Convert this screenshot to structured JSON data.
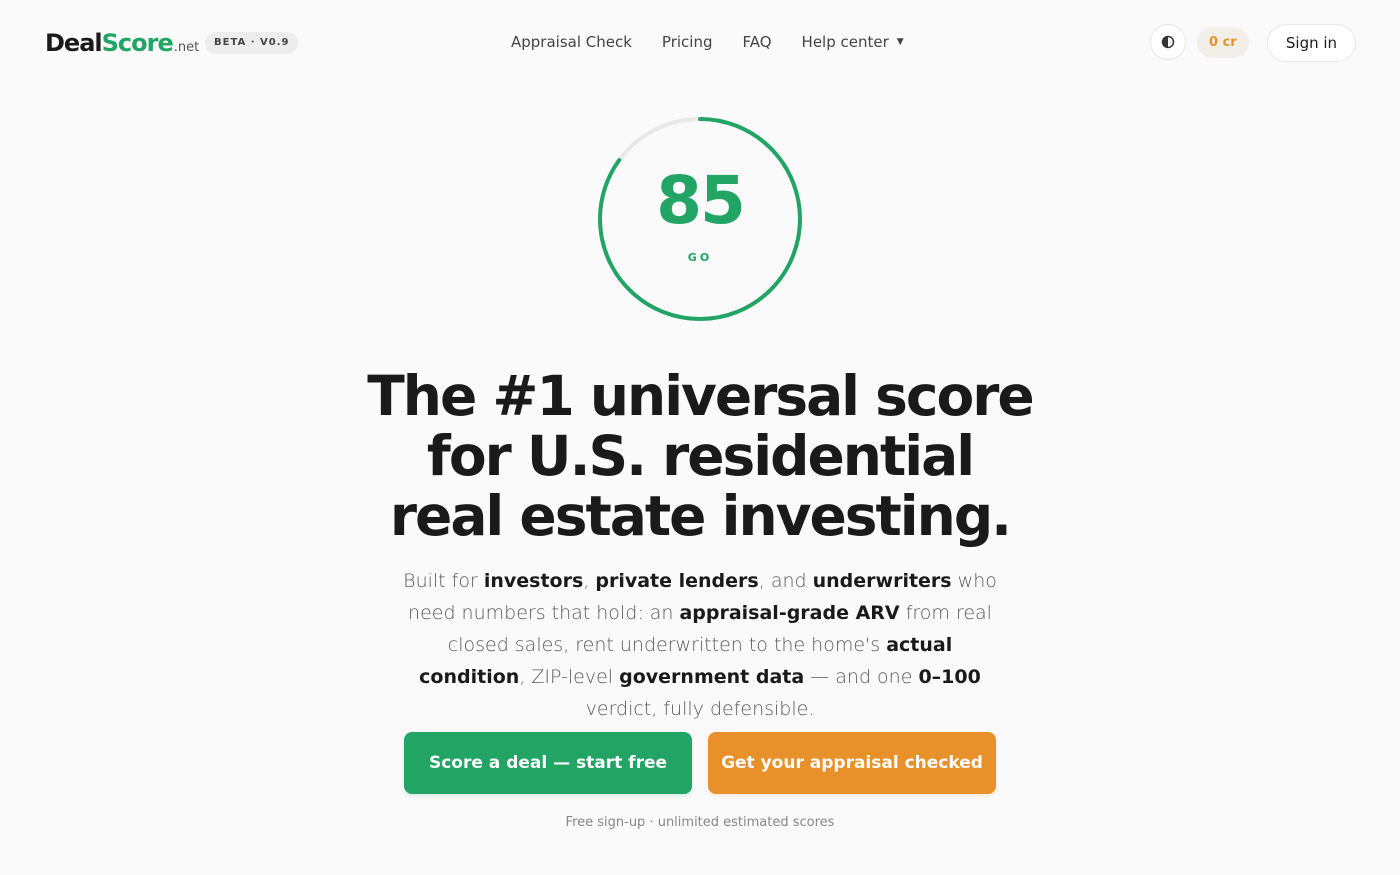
{
  "header": {
    "logo": {
      "part1": "Deal",
      "part2": "Score",
      "tld": ".net"
    },
    "badge": "BETA · V0.9",
    "nav": [
      {
        "label": "Appraisal Check"
      },
      {
        "label": "Pricing"
      },
      {
        "label": "FAQ"
      },
      {
        "label": "Help center"
      }
    ],
    "theme_icon": "half-circle-icon",
    "credits": "0 cr",
    "signin_label": "Sign in"
  },
  "score": {
    "value": "85",
    "verdict": "GO",
    "fraction": 0.85
  },
  "headline": {
    "line1": "The #1 universal score",
    "line2": "for U.S. residential",
    "line3": "real estate investing."
  },
  "subtext": {
    "t1": "Built for ",
    "b1": "investors",
    "t2": ", ",
    "b2": "private lenders",
    "t3": ", and ",
    "b3": "underwriters",
    "t4": " who need numbers that hold: an ",
    "b4": "appraisal-grade ARV",
    "t5": " from real closed sales, rent underwritten to the home's ",
    "b5": "actual condition",
    "t6": ", ZIP-level ",
    "b6": "government data",
    "t7": " — and one ",
    "b7": "0–100",
    "t8": " verdict, fully defensible."
  },
  "cta": {
    "primary": "Score a deal — start free",
    "secondary": "Get your appraisal checked"
  },
  "footnote": "Free sign-up · unlimited estimated scores",
  "colors": {
    "brand_green": "#21a464",
    "accent_orange": "#e8912b"
  }
}
